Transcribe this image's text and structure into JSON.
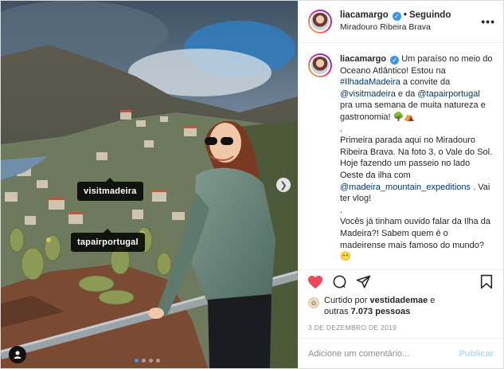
{
  "post": {
    "username": "liacamargo",
    "follow_separator": "•",
    "follow_status": "Seguindo",
    "location": "Miradouro Ribeira Brava",
    "more_icon": "more-options-icon"
  },
  "photo": {
    "tags": [
      "visitmadeira",
      "tapairportugal"
    ],
    "carousel_dots": 4,
    "active_dot": 0
  },
  "caption": {
    "username": "liacamargo",
    "line1_text": " Um paraíso no meio do Oceano Atlântico! Estou na ",
    "hashtag": "#IlhadaMadeira",
    "line2_text": " a convite da ",
    "mention1": "@visitmadeira",
    "line3_text": " e da ",
    "mention2": "@tapairportugal",
    "line4_text": " pra uma semana de muita natureza e gastronomia! 🌳⛺",
    "dot1": ".",
    "para2_a": "Primeira parada aqui no Miradouro Ribeira Brava. Na foto 3, o Vale do Sol. Hoje fazendo um passeio no lado Oeste da ilha com ",
    "mention3": "@madeira_mountain_expeditions",
    "para2_b": " . Vai ter vlog!",
    "dot2": ".",
    "para3": "Vocês já tinham ouvido falar da Ilha da Madeira?! Sabem quem é o madeirense mais famoso do mundo? 😶",
    "dot3": "."
  },
  "likes": {
    "prefix": "Curtido por ",
    "liker": "vestidademae",
    "middle": "outras ",
    "count": "7.073 pessoas"
  },
  "date": "3 DE DEZEMBRO DE 2019",
  "comment": {
    "placeholder": "Adicione um comentário...",
    "publish_label": "Publicar"
  },
  "colors": {
    "like_red": "#ed4956",
    "link_blue": "#00376b",
    "verified_blue": "#3897f0",
    "publish_disabled": "#b2dffc"
  }
}
